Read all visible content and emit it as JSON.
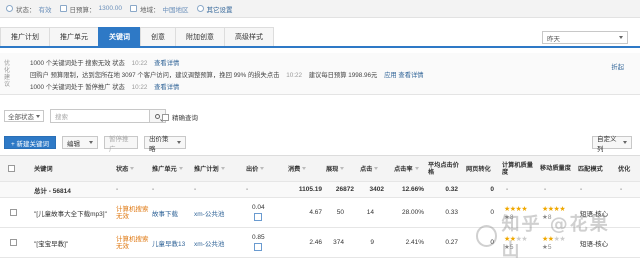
{
  "status_bar": {
    "status_label": "状态：",
    "status_value": "有效",
    "budget_label": "日预算：",
    "budget_value": "1300.00",
    "region_label": "地域：",
    "region_value": "中国地区",
    "settings_label": "其它设置"
  },
  "tabs": [
    {
      "label": "推广计划",
      "active": false
    },
    {
      "label": "推广单元",
      "active": false
    },
    {
      "label": "关键词",
      "active": true
    },
    {
      "label": "创意",
      "active": false
    },
    {
      "label": "附加创意",
      "active": false
    },
    {
      "label": "高级样式",
      "active": false
    }
  ],
  "date_select": {
    "value": "昨天"
  },
  "suggestions": {
    "side_label": "优化建议",
    "lines": [
      {
        "lead": "1000 个关键词处于 搜索无效 状态",
        "time": "10:22",
        "link": "查看详情"
      },
      {
        "lead": "回购户 预算限制，达到您所在地 3097 个客户访问，建议调整预算，挽回 99% 的损失点击",
        "time": "10:22",
        "extra": "建议每日预算 1998.96元",
        "link": "应用 查看详情"
      },
      {
        "lead": "1000 个关键词处于 暂停推广 状态",
        "time": "10:22",
        "link": "查看详情"
      }
    ],
    "collapse_label": "折起"
  },
  "filter": {
    "status_select": "全部状态",
    "search_placeholder": "搜索",
    "precise_label": "精确查询"
  },
  "toolbar": {
    "new_keyword": "+ 新建关键词",
    "edit": "编辑",
    "pause": "暂停推广",
    "bid_strategy": "出价策略",
    "custom_columns": "自定义列"
  },
  "table": {
    "headers": [
      "关键词",
      "状态",
      "推广单元",
      "推广计划",
      "出价",
      "消费",
      "展现",
      "点击",
      "点击率",
      "平均点击价格",
      "网页转化",
      "计算机质量度",
      "移动质量度",
      "匹配模式",
      "优化"
    ],
    "total": {
      "label": "总计 - 56814",
      "status": "-",
      "unit": "-",
      "plan": "-",
      "bid": "-",
      "cost": "1105.19",
      "impressions": "26872",
      "clicks": "3402",
      "ctr": "12.66%",
      "avg_cpc": "0.32",
      "conversions": "0",
      "pc_quality": "-",
      "mobile_quality": "-",
      "match": "-",
      "optimize": "-"
    },
    "rows": [
      {
        "keyword": "\"[儿童故事大全下载mp3]\"",
        "status": "计算机搜索无效",
        "unit": "故事下载",
        "plan": "xm-公共池",
        "bid": "0.04",
        "cost": "4.67",
        "impressions": "50",
        "clicks": "14",
        "ctr": "28.00%",
        "avg_cpc": "0.33",
        "conversions": "0",
        "pc_quality_stars": 4,
        "pc_quality_text": "★8",
        "mobile_quality_stars": 4,
        "mobile_quality_text": "★8",
        "match": "短语-核心"
      },
      {
        "keyword": "\"[宝宝早教]\"",
        "status": "计算机搜索无效",
        "unit": "儿童早教13",
        "plan": "xm-公共池",
        "bid": "0.85",
        "cost": "2.46",
        "impressions": "374",
        "clicks": "9",
        "ctr": "2.41%",
        "avg_cpc": "0.27",
        "conversions": "0",
        "pc_quality_stars": 2,
        "pc_quality_text": "★5",
        "mobile_quality_stars": 2,
        "mobile_quality_text": "★5",
        "match": "短语-核心"
      }
    ]
  },
  "watermark": "知乎 @花果山"
}
